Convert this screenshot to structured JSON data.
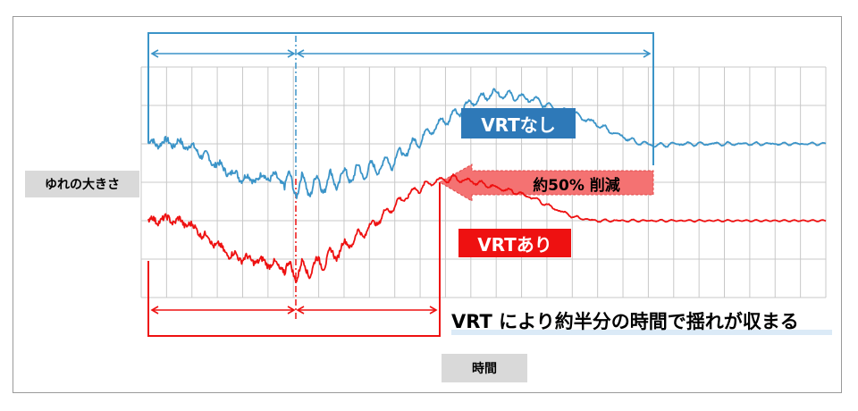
{
  "chart_data": {
    "type": "line",
    "xlabel": "時間",
    "ylabel": "ゆれの大きさ",
    "grid": true,
    "series": [
      {
        "name": "VRTなし",
        "color": "#3b94c8",
        "profile": [
          [
            0,
            0.0
          ],
          [
            3,
            0.02
          ],
          [
            6,
            -0.02
          ],
          [
            9,
            -0.18
          ],
          [
            12,
            -0.34
          ],
          [
            15,
            -0.42
          ],
          [
            18,
            -0.38
          ],
          [
            21,
            -0.48
          ],
          [
            24,
            -0.5
          ],
          [
            27,
            -0.44
          ],
          [
            30,
            -0.36
          ],
          [
            33,
            -0.3
          ],
          [
            36,
            -0.2
          ],
          [
            39,
            -0.02
          ],
          [
            42,
            0.18
          ],
          [
            45,
            0.34
          ],
          [
            48,
            0.5
          ],
          [
            51,
            0.6
          ],
          [
            54,
            0.56
          ],
          [
            57,
            0.52
          ],
          [
            60,
            0.42
          ],
          [
            63,
            0.34
          ],
          [
            66,
            0.24
          ],
          [
            69,
            0.12
          ],
          [
            72,
            0.02
          ],
          [
            75,
            -0.02
          ],
          [
            78,
            0.0
          ],
          [
            100,
            0.0
          ]
        ],
        "noise_amplitude": 0.07,
        "decay_amplitude": 0.14
      },
      {
        "name": "VRTあり",
        "color": "#ee1111",
        "profile": [
          [
            0,
            0.0
          ],
          [
            3,
            0.02
          ],
          [
            6,
            -0.04
          ],
          [
            9,
            -0.22
          ],
          [
            12,
            -0.4
          ],
          [
            15,
            -0.46
          ],
          [
            18,
            -0.5
          ],
          [
            21,
            -0.6
          ],
          [
            24,
            -0.56
          ],
          [
            27,
            -0.42
          ],
          [
            30,
            -0.24
          ],
          [
            33,
            -0.06
          ],
          [
            36,
            0.16
          ],
          [
            39,
            0.34
          ],
          [
            42,
            0.46
          ],
          [
            45,
            0.5
          ],
          [
            48,
            0.46
          ],
          [
            51,
            0.4
          ],
          [
            54,
            0.34
          ],
          [
            57,
            0.26
          ],
          [
            60,
            0.14
          ],
          [
            63,
            0.04
          ],
          [
            66,
            0.0
          ],
          [
            100,
            0.0
          ]
        ],
        "noise_amplitude": 0.07,
        "decay_amplitude": 0.12
      }
    ],
    "annotations": {
      "without_label": "VRTなし",
      "with_label": "VRTあり",
      "reduction": "約50% 削減",
      "caption": "VRT により約半分の時間で揺れが収まる"
    }
  }
}
